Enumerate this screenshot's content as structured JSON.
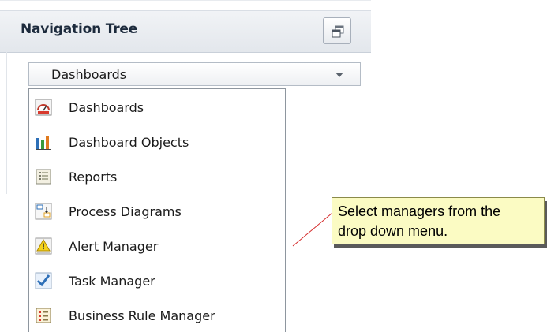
{
  "panel": {
    "title": "Navigation Tree"
  },
  "dropdown": {
    "selected": "Dashboards"
  },
  "menu": {
    "items": [
      {
        "label": "Dashboards",
        "icon": "dashboard-gauge-icon"
      },
      {
        "label": "Dashboard Objects",
        "icon": "bar-chart-icon"
      },
      {
        "label": "Reports",
        "icon": "report-icon"
      },
      {
        "label": "Process Diagrams",
        "icon": "process-diagram-icon"
      },
      {
        "label": "Alert Manager",
        "icon": "alert-warning-icon"
      },
      {
        "label": "Task Manager",
        "icon": "task-checkmark-icon"
      },
      {
        "label": "Business Rule Manager",
        "icon": "business-rule-icon"
      }
    ]
  },
  "callout": {
    "line1": "Select managers from the",
    "line2": "drop down menu."
  },
  "colors": {
    "callout_bg": "#fbfbc3",
    "header_bg": "#e8ebef",
    "menu_border": "#8e969f"
  }
}
